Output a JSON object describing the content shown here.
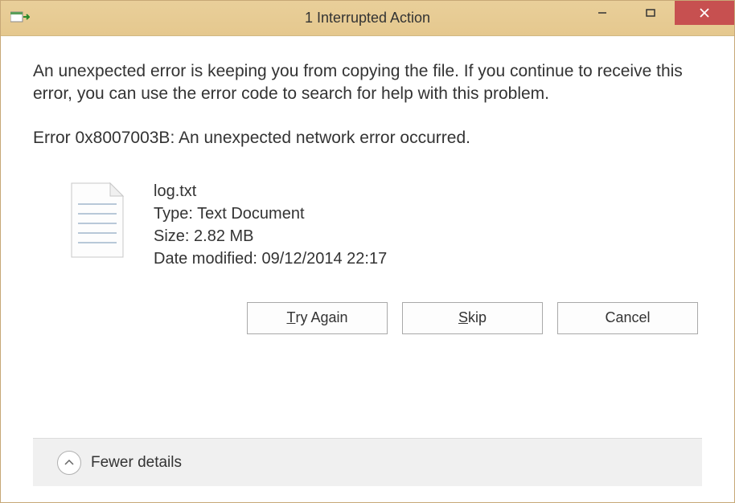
{
  "titlebar": {
    "title": "1 Interrupted Action"
  },
  "content": {
    "error_message": "An unexpected error is keeping you from copying the file. If you continue to receive this error, you can use the error code to search for help with this problem.",
    "error_code_line": "Error 0x8007003B: An unexpected network error occurred."
  },
  "file": {
    "name": "log.txt",
    "type_label": "Type:",
    "type_value": "Text Document",
    "size_label": "Size:",
    "size_value": "2.82 MB",
    "modified_label": "Date modified:",
    "modified_value": "09/12/2014 22:17"
  },
  "buttons": {
    "try_again_prefix": "T",
    "try_again_suffix": "ry Again",
    "skip_prefix": "S",
    "skip_suffix": "kip",
    "cancel": "Cancel"
  },
  "footer": {
    "details_label": "Fewer details"
  }
}
